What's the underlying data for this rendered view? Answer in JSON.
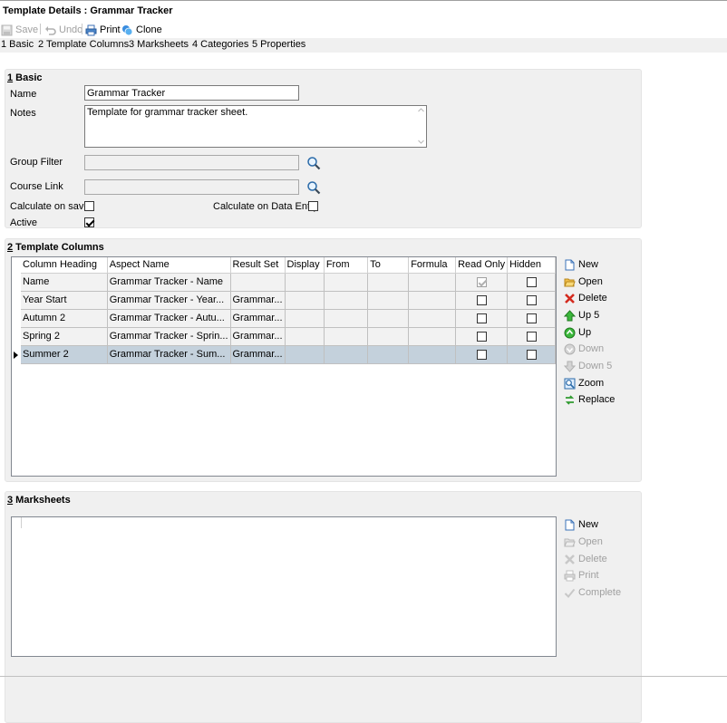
{
  "window": {
    "title": "Template Details : Grammar Tracker"
  },
  "toolbar": {
    "save": "Save",
    "undo": "Undo",
    "print": "Print",
    "clone": "Clone"
  },
  "tabs": [
    "1 Basic",
    "2 Template Columns",
    "3 Marksheets",
    "4 Categories",
    "5 Properties"
  ],
  "basic": {
    "section_num": "1",
    "section_label": " Basic",
    "name_label": "Name",
    "name_value": "Grammar Tracker",
    "notes_label": "Notes",
    "notes_value": "Template for grammar tracker sheet.",
    "group_filter_label": "Group Filter",
    "group_filter_value": "",
    "course_link_label": "Course Link",
    "course_link_value": "",
    "calc_save_label": "Calculate on save",
    "calc_save_checked": false,
    "calc_entry_label": "Calculate on Data Entry",
    "calc_entry_checked": false,
    "active_label": "Active",
    "active_checked": true
  },
  "template_columns": {
    "section_num": "2",
    "section_label": " Template Columns",
    "headers": [
      "Column Heading",
      "Aspect Name",
      "Result Set",
      "Display",
      "From",
      "To",
      "Formula",
      "Read Only",
      "Hidden"
    ],
    "rows": [
      {
        "heading": "Name",
        "aspect": "Grammar Tracker - Name",
        "result": "",
        "display": "",
        "from": "",
        "to": "",
        "formula": "",
        "read_only": true,
        "read_only_disabled": true,
        "hidden": false,
        "selected": false
      },
      {
        "heading": "Year Start",
        "aspect": "Grammar Tracker - Year...",
        "result": "Grammar...",
        "display": "",
        "from": "",
        "to": "",
        "formula": "",
        "read_only": false,
        "read_only_disabled": false,
        "hidden": false,
        "selected": false
      },
      {
        "heading": "Autumn 2",
        "aspect": "Grammar Tracker - Autu...",
        "result": "Grammar...",
        "display": "",
        "from": "",
        "to": "",
        "formula": "",
        "read_only": false,
        "read_only_disabled": false,
        "hidden": false,
        "selected": false
      },
      {
        "heading": "Spring 2",
        "aspect": "Grammar Tracker - Sprin...",
        "result": "Grammar...",
        "display": "",
        "from": "",
        "to": "",
        "formula": "",
        "read_only": false,
        "read_only_disabled": false,
        "hidden": false,
        "selected": false
      },
      {
        "heading": "Summer 2",
        "aspect": "Grammar Tracker - Sum...",
        "result": "Grammar...",
        "display": "",
        "from": "",
        "to": "",
        "formula": "",
        "read_only": false,
        "read_only_disabled": false,
        "hidden": false,
        "selected": true
      }
    ],
    "actions": {
      "new": "New",
      "open": "Open",
      "delete": "Delete",
      "up5": "Up 5",
      "up": "Up",
      "down": "Down",
      "down5": "Down 5",
      "zoom": "Zoom",
      "replace": "Replace"
    }
  },
  "marksheets": {
    "section_num": "3",
    "section_label": " Marksheets",
    "actions": {
      "new": "New",
      "open": "Open",
      "delete": "Delete",
      "print": "Print",
      "complete": "Complete"
    }
  },
  "colors": {
    "panel_bg": "#f0f0f0",
    "selected_row": "#c4d1dc",
    "disabled_text": "#a0a0a0"
  }
}
